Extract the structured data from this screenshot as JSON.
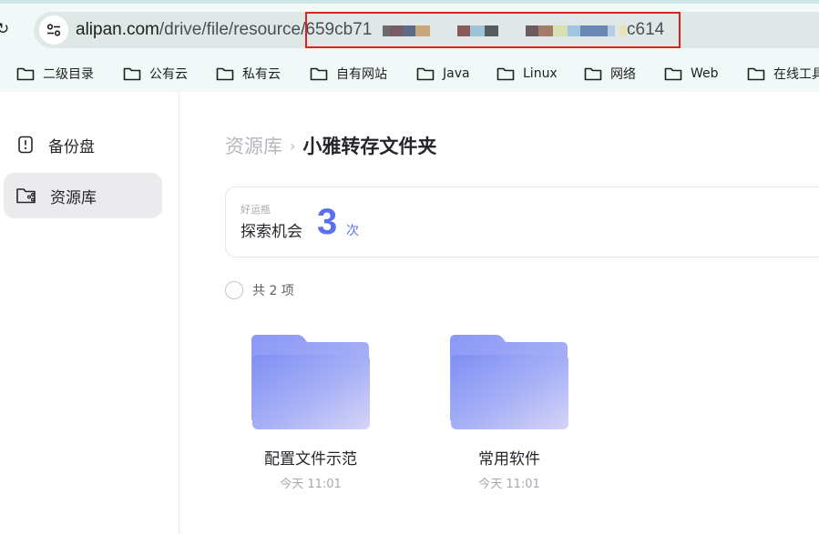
{
  "browser": {
    "url_host": "alipan.com",
    "url_path": "/drive/file/resource/",
    "url_visible_start": "659cb71",
    "url_visible_end": "c614"
  },
  "bookmarks": [
    {
      "label": "二级目录"
    },
    {
      "label": "公有云"
    },
    {
      "label": "私有云"
    },
    {
      "label": "自有网站"
    },
    {
      "label": "Java"
    },
    {
      "label": "Linux"
    },
    {
      "label": "网络"
    },
    {
      "label": "Web"
    },
    {
      "label": "在线工具"
    }
  ],
  "sidebar": {
    "items": [
      {
        "label": "备份盘",
        "icon": "backup-drive-icon",
        "active": false
      },
      {
        "label": "资源库",
        "icon": "resource-folder-icon",
        "active": true
      }
    ]
  },
  "breadcrumb": {
    "root": "资源库",
    "separator": "›",
    "current": "小雅转存文件夹"
  },
  "lucky_card": {
    "small_label": "好运瓶",
    "label": "探索机会",
    "count": "3",
    "unit": "次"
  },
  "list": {
    "count_text": "共 2 项"
  },
  "files": [
    {
      "name": "配置文件示范",
      "time": "今天 11:01"
    },
    {
      "name": "常用软件",
      "time": "今天 11:01"
    }
  ],
  "colors": {
    "accent": "#5a71ee",
    "folder": "#8f9cf6",
    "highlight_box": "#e0201d"
  }
}
